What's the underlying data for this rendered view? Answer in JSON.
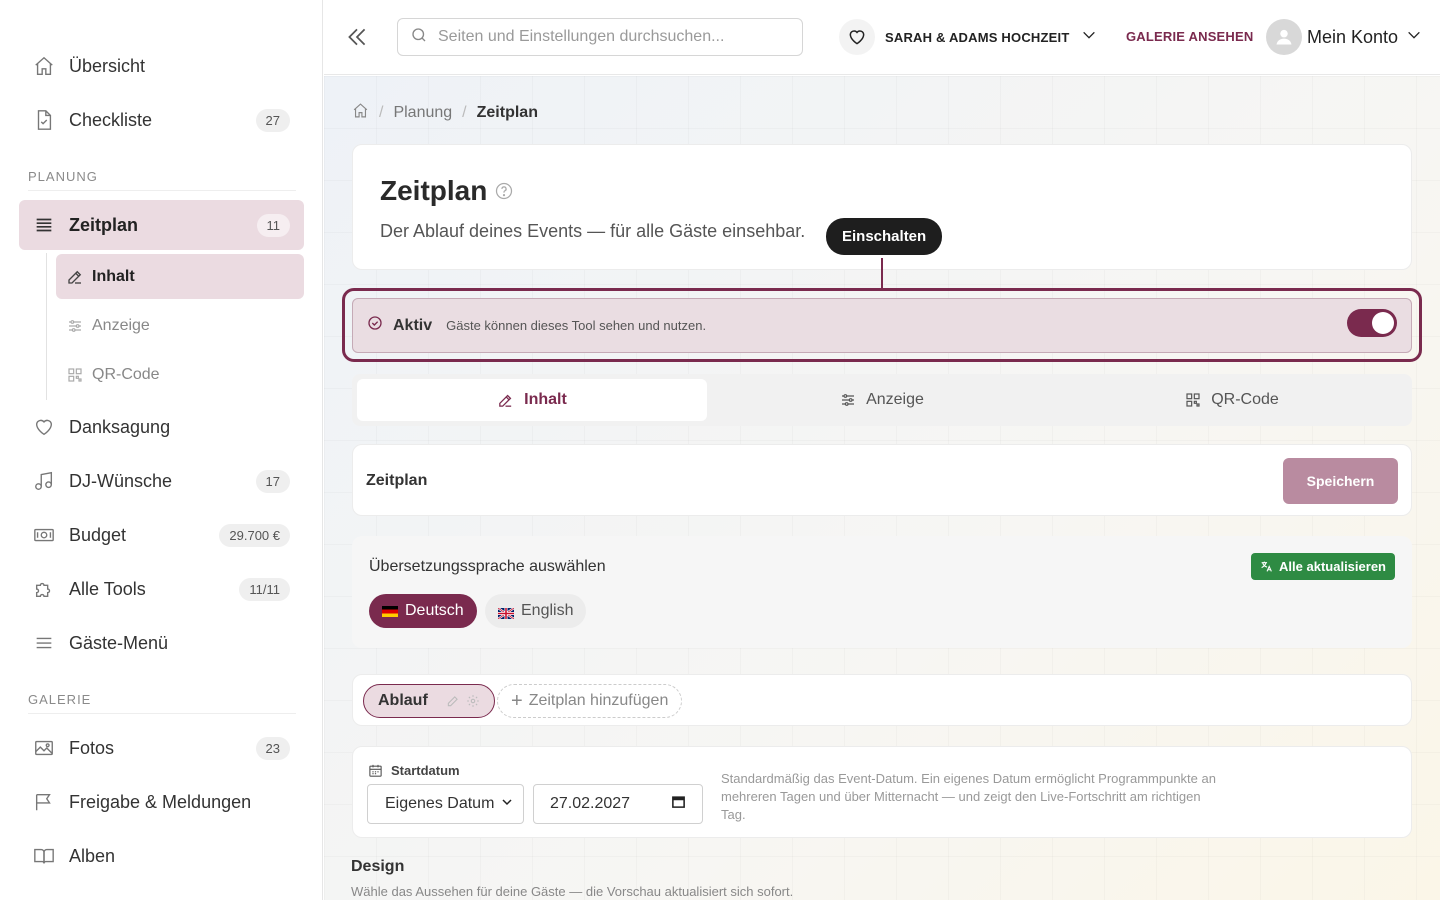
{
  "sidebar": {
    "items": [
      {
        "label": "Übersicht"
      },
      {
        "label": "Checkliste",
        "badge": "27"
      }
    ],
    "planung_title": "PLANUNG",
    "zeitplan": {
      "label": "Zeitplan",
      "badge": "11"
    },
    "sub_items": [
      {
        "label": "Inhalt"
      },
      {
        "label": "Anzeige"
      },
      {
        "label": "QR-Code"
      }
    ],
    "planung_items": [
      {
        "label": "Danksagung"
      },
      {
        "label": "DJ-Wünsche",
        "badge": "17"
      },
      {
        "label": "Budget",
        "badge": "29.700 €"
      },
      {
        "label": "Alle Tools",
        "badge": "11/11"
      },
      {
        "label": "Gäste-Menü"
      }
    ],
    "galerie_title": "GALERIE",
    "galerie_items": [
      {
        "label": "Fotos",
        "badge": "23"
      },
      {
        "label": "Freigabe & Meldungen"
      },
      {
        "label": "Alben"
      }
    ]
  },
  "topbar": {
    "search_placeholder": "Seiten und Einstellungen durchsuchen...",
    "event_name": "SARAH & ADAMS HOCHZEIT",
    "gallery_link": "GALERIE ANSEHEN",
    "account_label": "Mein Konto"
  },
  "breadcrumb": {
    "level1": "Planung",
    "current": "Zeitplan"
  },
  "header": {
    "title": "Zeitplan",
    "subtitle": "Der Ablauf deines Events — für alle Gäste einsehbar."
  },
  "tooltip": "Einschalten",
  "status": {
    "label": "Aktiv",
    "description": "Gäste können dieses Tool sehen und nutzen.",
    "enabled": true
  },
  "tabs": [
    {
      "label": "Inhalt",
      "active": true
    },
    {
      "label": "Anzeige",
      "active": false
    },
    {
      "label": "QR-Code",
      "active": false
    }
  ],
  "section": {
    "title": "Zeitplan",
    "save_label": "Speichern"
  },
  "translation": {
    "title": "Übersetzungssprache auswählen",
    "update_all": "Alle aktualisieren",
    "languages": [
      {
        "label": "Deutsch",
        "selected": true
      },
      {
        "label": "English",
        "selected": false
      }
    ]
  },
  "timeline": {
    "current": "Ablauf",
    "add_label": "Zeitplan hinzufügen"
  },
  "startdate": {
    "label": "Startdatum",
    "mode": "Eigenes Datum",
    "date": "27.02.2027",
    "hint": "Standardmäßig das Event-Datum. Ein eigenes Datum ermöglicht Programmpunkte an mehreren Tagen und über Mitternacht — und zeigt den Live-Fortschritt am richtigen Tag."
  },
  "design": {
    "title": "Design",
    "subtitle": "Wähle das Aussehen für deine Gäste — die Vorschau aktualisiert sich sofort."
  },
  "colors": {
    "accent": "#7a2a4e",
    "success": "#2e8b43"
  }
}
